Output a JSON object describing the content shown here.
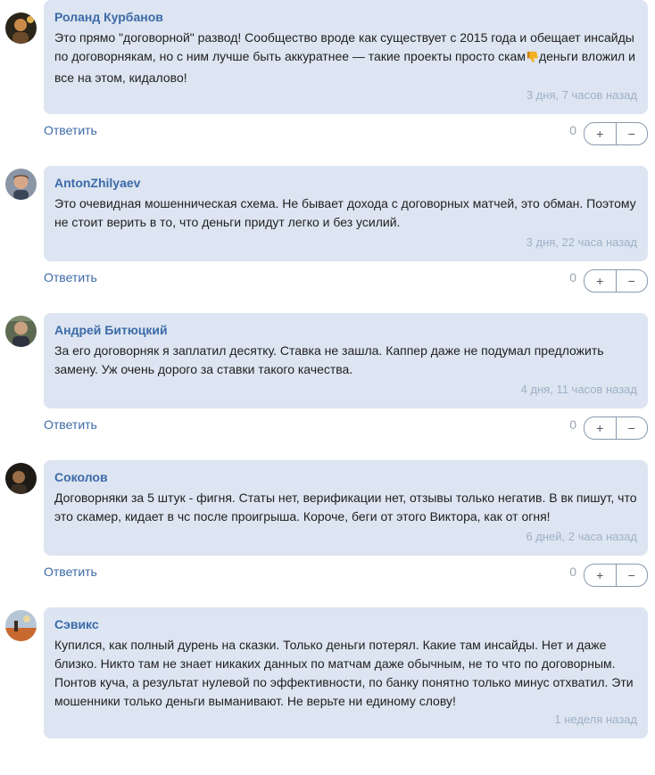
{
  "comments": [
    {
      "author": "Роланд Курбанов",
      "text_before": "Это прямо \"договорной\" развод! Сообщество вроде как существует с 2015 года и обещает инсайды по договорнякам, но с ним лучше быть аккуратнее — такие проекты просто скам",
      "emoji": "thumbs-down-emoji",
      "text_after": "деньги вложил и все на этом, кидалово!",
      "time": "3 дня, 7 часов назад",
      "score": "0",
      "avatar": "avatar-roland"
    },
    {
      "author": "AntonZhilyaev",
      "text_before": "Это очевидная мошенническая схема. Не бывает дохода с договорных матчей, это обман. Поэтому не стоит верить в то, что деньги придут легко и без усилий.",
      "text_after": "",
      "time": "3 дня, 22 часа назад",
      "score": "0",
      "avatar": "avatar-anton"
    },
    {
      "author": "Андрей Битюцкий",
      "text_before": "За его договорняк я заплатил десятку. Ставка не зашла. Каппер даже не подумал предложить замену. Уж очень дорого за ставки такого качества.",
      "text_after": "",
      "time": "4 дня, 11 часов назад",
      "score": "0",
      "avatar": "avatar-andrey"
    },
    {
      "author": "Соколов",
      "text_before": "Договорняки за 5 штук - фигня. Статы нет, верификации нет, отзывы только негатив. В вк пишут, что это скамер, кидает в чс после проигрыша. Короче, беги от этого Виктора, как от огня!",
      "text_after": "",
      "time": "6 дней, 2 часа назад",
      "score": "0",
      "avatar": "avatar-sokolov"
    },
    {
      "author": "Сэвикс",
      "text_before": "Купился, как полный дурень на сказки. Только деньги потерял. Какие там инсайды. Нет и даже близко. Никто там не знает никаких данных по матчам даже обычным, не то что по договорным. Понтов куча, а результат нулевой по эффективности, по банку понятно только минус отхватил. Эти мошенники только деньги выманивают. Не верьте ни единому слову!",
      "text_after": "",
      "time": "1 неделя назад",
      "score": null,
      "avatar": "avatar-seviks"
    }
  ],
  "labels": {
    "reply": "Ответить",
    "plus": "+",
    "minus": "−"
  },
  "colors": {
    "bubble": "#dce5f1",
    "author": "#3c6aa8",
    "time": "#9fb0c8",
    "emoji": "#e8a317"
  }
}
